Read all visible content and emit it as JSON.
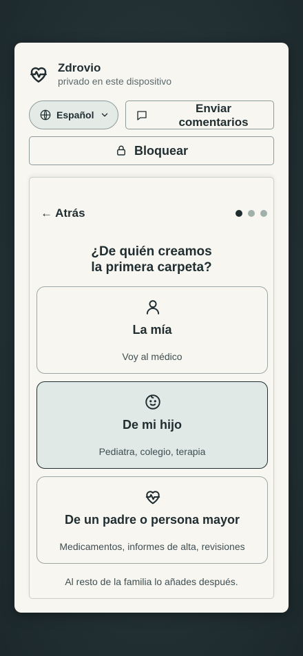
{
  "brand": {
    "name": "Zdrovio",
    "subtitle": "privado en este dispositivo",
    "icon": "heart-pulse-icon"
  },
  "toolbar": {
    "language_label": "Español",
    "feedback_label_line1": "Enviar",
    "feedback_label_line2": "comentarios",
    "lock_label": "Bloquear"
  },
  "wizard": {
    "back_label": "← Atrás",
    "steps_total": 3,
    "current_step": 1,
    "question_line1": "¿De quién creamos",
    "question_line2": "la primera carpeta?",
    "options": [
      {
        "title": "La mía",
        "subtitle": "Voy al médico",
        "icon": "user-icon",
        "selected": false
      },
      {
        "title": "De mi hijo",
        "subtitle": "Pediatra, colegio, terapia",
        "icon": "baby-face-icon",
        "selected": true
      },
      {
        "title": "De un padre o persona mayor",
        "subtitle": "Medicamentos, informes de alta, revisiones",
        "icon": "heart-pulse-icon",
        "selected": false
      }
    ],
    "footer_note": "Al resto de la familia lo añades después."
  },
  "colors": {
    "background": "#223034",
    "panel": "#f8f6f0",
    "text": "#1f2d31",
    "selected_option": "#e0e9e5",
    "step_dot_inactive": "#9fb1aa"
  }
}
